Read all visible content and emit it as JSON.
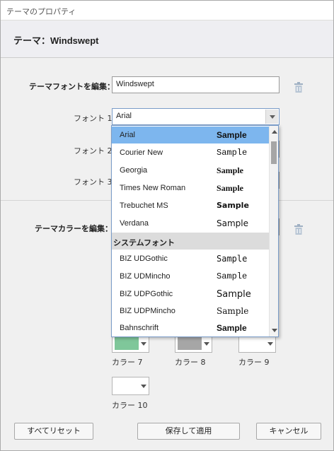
{
  "window": {
    "title": "テーマのプロパティ"
  },
  "header": {
    "title": "テーマ：Windswept"
  },
  "theme_font": {
    "label": "テーマフォントを編集：",
    "name_value": "Windswept",
    "delete_icon": "trash-icon"
  },
  "fonts": {
    "font1_label": "フォント 1",
    "font1_value": "Arial",
    "font2_label": "フォント 2",
    "font3_label": "フォント 3"
  },
  "theme_color": {
    "label": "テーマカラーを編集：",
    "delete_icon": "trash-icon"
  },
  "colors": [
    {
      "label": "カラー 7",
      "fill": "#7fc79a"
    },
    {
      "label": "カラー 8",
      "fill": "#a6a6a6"
    },
    {
      "label": "カラー 9",
      "fill": "#ffffff"
    },
    {
      "label": "カラー 10",
      "fill": "#ffffff"
    }
  ],
  "dropdown": {
    "selected": "Arial",
    "items": [
      {
        "name": "Arial",
        "sample": "Sample"
      },
      {
        "name": "Courier New",
        "sample": "Sample"
      },
      {
        "name": "Georgia",
        "sample": "Sample"
      },
      {
        "name": "Times New Roman",
        "sample": "Sample"
      },
      {
        "name": "Trebuchet MS",
        "sample": "Sample"
      },
      {
        "name": "Verdana",
        "sample": "Sample"
      },
      {
        "name": "システムフォント",
        "group": true
      },
      {
        "name": "BIZ UDGothic",
        "sample": "Sample"
      },
      {
        "name": "BIZ UDMincho",
        "sample": "Sample"
      },
      {
        "name": "BIZ UDPGothic",
        "sample": "Sample"
      },
      {
        "name": "BIZ UDPMincho",
        "sample": "Sample"
      },
      {
        "name": "Bahnschrift",
        "sample": "Sample"
      }
    ]
  },
  "buttons": {
    "reset_all": "すべてリセット",
    "save_apply": "保存して適用",
    "cancel": "キャンセル"
  }
}
